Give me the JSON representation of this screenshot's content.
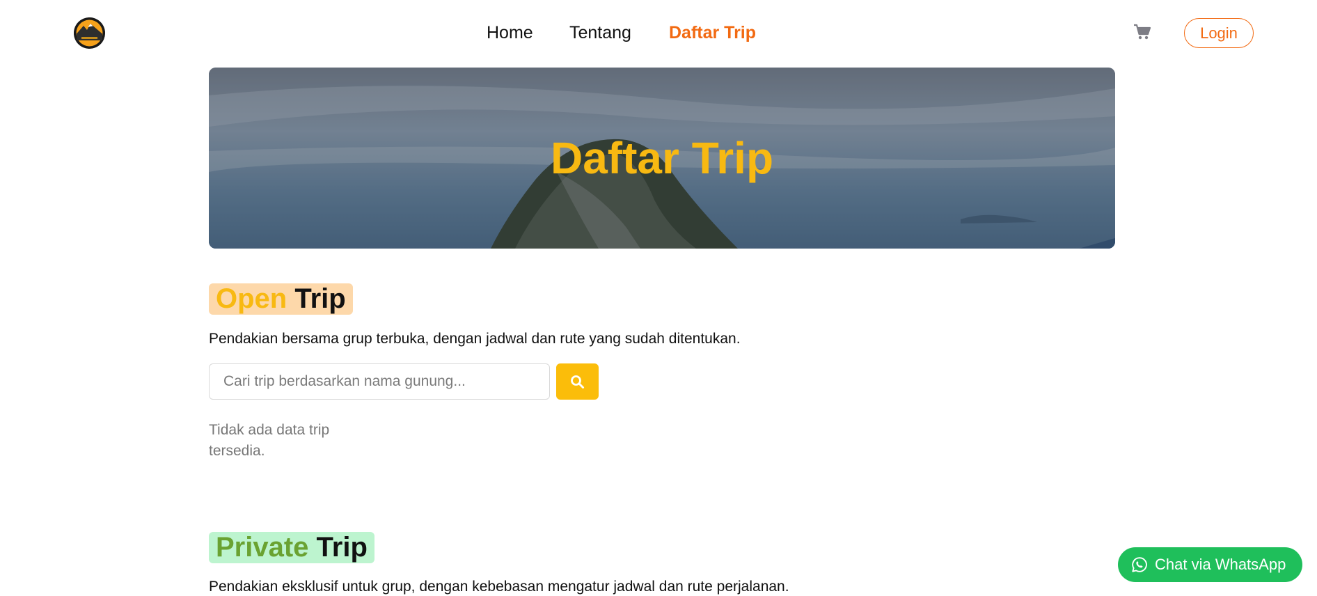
{
  "nav": {
    "logo_icon": "mountain-logo-icon",
    "links": [
      {
        "label": "Home"
      },
      {
        "label": "Tentang"
      },
      {
        "label": "Daftar Trip",
        "active": true
      }
    ],
    "cart_icon": "shopping-cart-icon",
    "login_label": "Login"
  },
  "hero": {
    "title": "Daftar Trip"
  },
  "open_trip": {
    "title_accent": "Open",
    "title_rest": " Trip",
    "description": "Pendakian bersama grup terbuka, dengan jadwal dan rute yang sudah ditentukan.",
    "search_placeholder": "Cari trip berdasarkan nama gunung...",
    "search_value": "",
    "search_icon": "search-icon",
    "empty_message": "Tidak ada data trip tersedia."
  },
  "private_trip": {
    "title_accent": "Private",
    "title_rest": " Trip",
    "description": "Pendakian eksklusif untuk grup, dengan kebebasan mengatur jadwal dan rute perjalanan."
  },
  "whatsapp": {
    "label": "Chat via WhatsApp",
    "icon": "whatsapp-icon"
  },
  "colors": {
    "brand_orange": "#f26a12",
    "accent_yellow": "#f8b912",
    "search_button": "#fbbd0a",
    "open_tag_bg": "#fdd8aa",
    "private_tag_bg": "#bdf4cf",
    "private_accent": "#6aa231",
    "whatsapp_green": "#1fbf5b"
  }
}
